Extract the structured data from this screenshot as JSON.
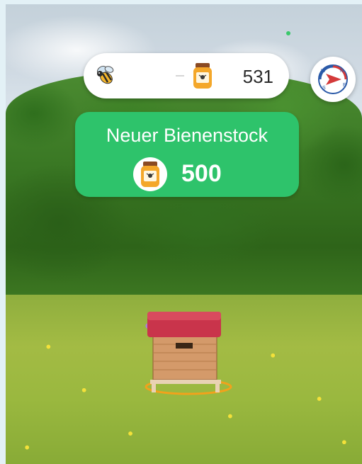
{
  "hud": {
    "bee_icon": "bee-icon",
    "honey_icon": "honey-jar-icon",
    "honey_count": "531"
  },
  "compass": {
    "icon": "compass-icon",
    "letters": [
      "N",
      "E",
      "S",
      "W"
    ]
  },
  "buy_card": {
    "title": "Neuer Bienenstock",
    "price_icon": "honey-jar-icon",
    "price": "500"
  },
  "colors": {
    "accent_green": "#2ec36b",
    "honey_orange": "#f4a72a",
    "hive_roof_red": "#c9344b"
  }
}
